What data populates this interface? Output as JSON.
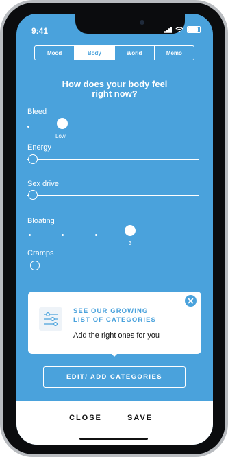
{
  "status": {
    "time": "9:41"
  },
  "tabs": [
    {
      "label": "Mood",
      "active": false
    },
    {
      "label": "Body",
      "active": true
    },
    {
      "label": "World",
      "active": false
    },
    {
      "label": "Memo",
      "active": false
    }
  ],
  "question": {
    "line1": "How does your body feel",
    "line2": "right now?"
  },
  "sliders": [
    {
      "label": "Bleed",
      "value_label": "Low",
      "level_index": 1,
      "steps": 4
    },
    {
      "label": "Energy",
      "value_label": "",
      "level_index": 0,
      "steps": 4
    },
    {
      "label": "Sex drive",
      "value_label": "",
      "level_index": 0,
      "steps": 4
    },
    {
      "label": "Bloating",
      "value_label": "3",
      "level_index": 3,
      "steps": 5
    },
    {
      "label": "Cramps",
      "value_label": "",
      "level_index": 0,
      "steps": 4
    }
  ],
  "card": {
    "title_line1": "SEE OUR GROWING",
    "title_line2": "LIST OF CATEGORIES",
    "subtitle": "Add the right ones for you",
    "icon": "sliders-icon",
    "close_icon": "close-icon"
  },
  "edit_button": {
    "label": "EDIT/ ADD CATEGORIES"
  },
  "bottom": {
    "close_label": "CLOSE",
    "save_label": "SAVE"
  },
  "colors": {
    "accent": "#4aa2dc",
    "background": "#4aa2dc",
    "card": "#ffffff",
    "text_dark": "#111111"
  }
}
